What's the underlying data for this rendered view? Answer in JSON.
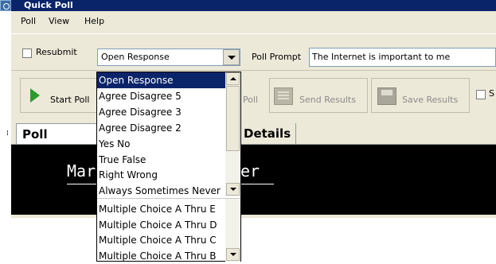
{
  "window": {
    "title": "Quick Poll"
  },
  "menu": [
    "Poll",
    "View",
    "Help"
  ],
  "toolbar": {
    "resubmit_label": "Resubmit",
    "response_type": "Open Response",
    "poll_prompt_label": "Poll Prompt",
    "poll_prompt_value": "The Internet is important to me",
    "start_poll_label": "Start Poll",
    "stop_poll_label": "Poll",
    "send_results_label": "Send Results",
    "save_results_label": "Save Results",
    "extra_check_label": "S"
  },
  "icons": {
    "start": "play-icon",
    "send": "send-results-icon",
    "save": "save-icon",
    "dropdown": "chevron-down-icon"
  },
  "tabs": [
    {
      "label": "Poll Prompt",
      "selected": true
    },
    {
      "label": "Details",
      "selected": false
    }
  ],
  "display": {
    "left_text": "Mar",
    "right_text": "er"
  },
  "dropdown": {
    "options": [
      "Open Response",
      "Agree Disagree 5",
      "Agree Disagree 3",
      "Agree Disagree 2",
      "Yes No",
      "True False",
      "Right Wrong",
      "Always Sometimes Never",
      "Multiple Choice A Thru E",
      "Multiple Choice A Thru D",
      "Multiple Choice A Thru C",
      "Multiple Choice A Thru B"
    ],
    "selected_index": 0
  },
  "colors": {
    "titlebar": "#0a246a",
    "selection": "#0a246a",
    "play": "#2e9a2e",
    "window_bg": "#ece9d8"
  }
}
